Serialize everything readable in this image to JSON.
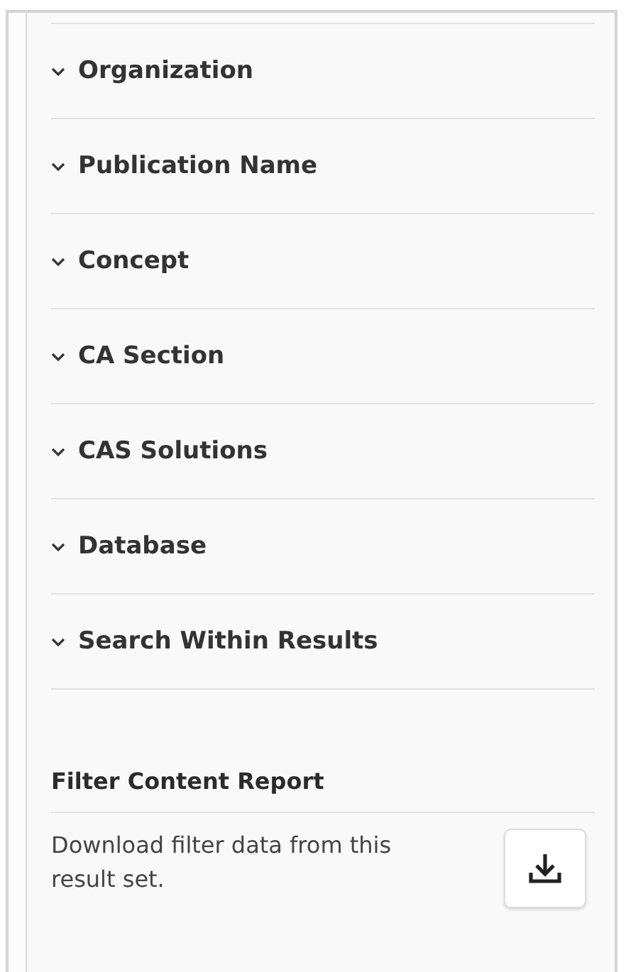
{
  "facets": [
    {
      "label": "Organization",
      "expanded": false
    },
    {
      "label": "Publication Name",
      "expanded": false
    },
    {
      "label": "Concept",
      "expanded": false
    },
    {
      "label": "CA Section",
      "expanded": false
    },
    {
      "label": "CAS Solutions",
      "expanded": false
    },
    {
      "label": "Database",
      "expanded": false
    },
    {
      "label": "Search Within Results",
      "expanded": false
    }
  ],
  "report": {
    "title": "Filter Content Report",
    "description": "Download filter data from this result set."
  }
}
